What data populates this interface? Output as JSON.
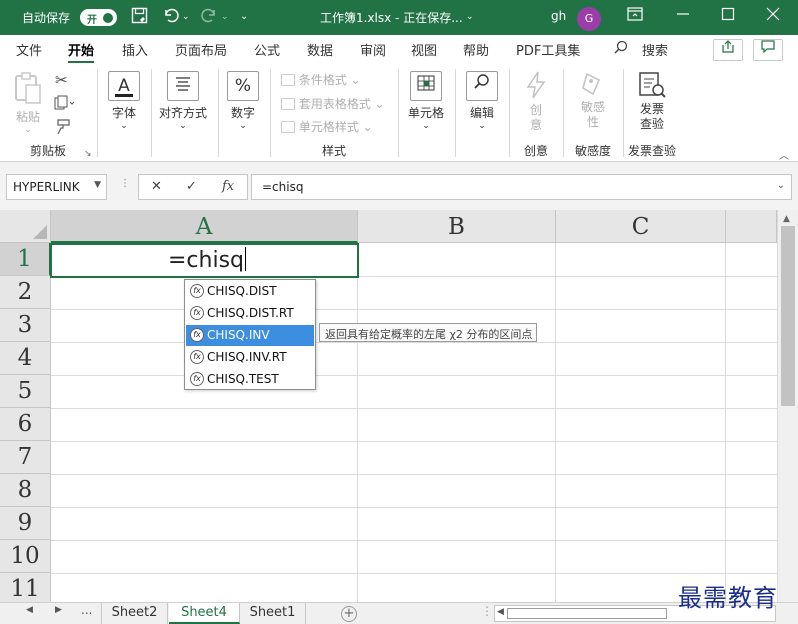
{
  "titlebar": {
    "autosave_label": "自动保存",
    "autosave_state": "开",
    "file_title": "工作簿1.xlsx - 正在保存...",
    "user_name": "gh",
    "avatar_initial": "G"
  },
  "tabs": [
    "文件",
    "开始",
    "插入",
    "页面布局",
    "公式",
    "数据",
    "审阅",
    "视图",
    "帮助",
    "PDF工具集"
  ],
  "search_label": "搜索",
  "ribbon": {
    "clipboard": {
      "paste": "粘贴",
      "name": "剪贴板"
    },
    "font": "字体",
    "alignment": "对齐方式",
    "number": "数字",
    "styles": {
      "cond_format": "条件格式",
      "table_format": "套用表格格式",
      "cell_styles": "单元格样式",
      "name": "样式"
    },
    "cells": "单元格",
    "editing": "编辑",
    "create": {
      "button": "创意",
      "name": "创意"
    },
    "sensitivity": {
      "button": "敏感性",
      "name": "敏感度"
    },
    "invoice": {
      "button": "发票查验",
      "name": "发票查验"
    }
  },
  "formula_bar": {
    "name_box": "HYPERLINK",
    "fx_label": "fx",
    "formula": "=chisq"
  },
  "grid": {
    "columns": [
      "A",
      "B",
      "C"
    ],
    "rows": [
      "1",
      "2",
      "3",
      "4",
      "5",
      "6",
      "7",
      "8",
      "9",
      "10",
      "11"
    ],
    "active_cell_text": "=chisq"
  },
  "autocomplete": {
    "items": [
      "CHISQ.DIST",
      "CHISQ.DIST.RT",
      "CHISQ.INV",
      "CHISQ.INV.RT",
      "CHISQ.TEST"
    ],
    "highlighted_index": 2,
    "tooltip": "返回具有给定概率的左尾 χ2 分布的区间点"
  },
  "sheet_tabs": {
    "more": "...",
    "tabs": [
      "Sheet2",
      "Sheet4",
      "Sheet1"
    ],
    "active": "Sheet4"
  },
  "watermark": "最需教育",
  "colors": {
    "brand": "#217346",
    "highlight": "#3c8ee0"
  }
}
